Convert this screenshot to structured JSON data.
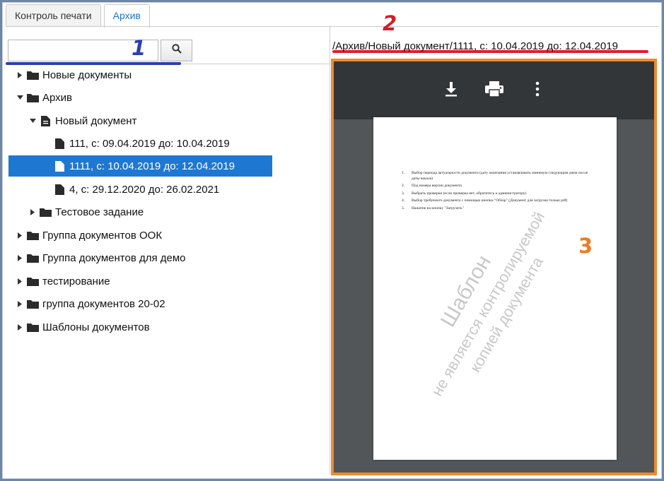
{
  "tabs": [
    {
      "label": "Контроль печати",
      "active": false
    },
    {
      "label": "Архив",
      "active": true
    }
  ],
  "search": {
    "value": "",
    "placeholder": "",
    "icon": "search-icon"
  },
  "annotations": {
    "one": "1",
    "two": "2",
    "three": "3"
  },
  "breadcrumb": "/Архив/Новый документ/1111, с: 10.04.2019 до: 12.04.2019",
  "tree": [
    {
      "label": "Новые документы",
      "icon": "folder-icon",
      "expanded": false,
      "level": 0
    },
    {
      "label": "Архив",
      "icon": "folder-icon",
      "expanded": true,
      "level": 0
    },
    {
      "label": "Новый документ",
      "icon": "document-text-icon",
      "expanded": true,
      "level": 1
    },
    {
      "label": "111, с: 09.04.2019 до: 10.04.2019",
      "icon": "file-icon",
      "level": 2
    },
    {
      "label": "1111, с: 10.04.2019 до: 12.04.2019",
      "icon": "file-icon",
      "level": 2,
      "selected": true
    },
    {
      "label": "4, с: 29.12.2020 до: 26.02.2021",
      "icon": "file-icon",
      "level": 2
    },
    {
      "label": "Тестовое задание",
      "icon": "folder-icon",
      "expanded": false,
      "level": 1
    },
    {
      "label": "Группа документов ООК",
      "icon": "folder-icon",
      "expanded": false,
      "level": 0
    },
    {
      "label": "Группа документов для демо",
      "icon": "folder-icon",
      "expanded": false,
      "level": 0
    },
    {
      "label": "тестирование",
      "icon": "folder-icon",
      "expanded": false,
      "level": 0
    },
    {
      "label": "группа документов 20-02",
      "icon": "folder-icon",
      "expanded": false,
      "level": 0
    },
    {
      "label": "Шаблоны документов",
      "icon": "folder-icon",
      "expanded": false,
      "level": 0
    }
  ],
  "viewer": {
    "toolbar": [
      "download-icon",
      "print-icon",
      "more-vertical-icon"
    ],
    "document_items": [
      {
        "n": "1.",
        "text": "Выбор периода актуальности документа (дату окончания устанавливать минимум следующим днем после даты начала)"
      },
      {
        "n": "2.",
        "text": "Под номера версии документа"
      },
      {
        "n": "3.",
        "text": "Выбрать проверки (если проверка нет, обратитесь к администратору)"
      },
      {
        "n": "4.",
        "text": "Выбор требуемого документа с помощью кнопки \"Обзор\" (Документ для загрузки только pdf)"
      },
      {
        "n": "5.",
        "text": "Нажатие на кнопку \"Загрузить\""
      }
    ],
    "watermark": [
      "Шаблон",
      "не является контролируемой",
      "копией документа"
    ]
  },
  "colors": {
    "selection": "#1e78d2",
    "annotation_blue": "#2b3fb0",
    "annotation_red": "#d11d2c",
    "annotation_orange": "#f07a22",
    "viewer_border": "#f08a2d",
    "viewer_toolbar": "#323639",
    "viewer_background": "#525659"
  }
}
